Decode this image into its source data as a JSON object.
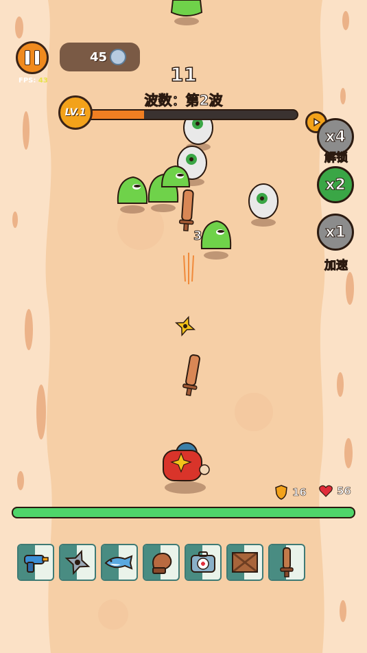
{
  "hud": {
    "fps_label": "FPS:",
    "fps_value": "43",
    "coins": "45",
    "timer": "11",
    "wave_text": "波数：第2波",
    "level": "LV.1",
    "xp_progress": 0.3
  },
  "speed": {
    "x4_label": "x4",
    "x4_caption": "解锁",
    "x2_label": "x2",
    "x1_label": "x1",
    "x1_caption": "加速"
  },
  "player": {
    "shield": "16",
    "hearts": "56",
    "hp_fraction": 1.0
  },
  "damage_popup": "3",
  "weapons": [
    "water-gun-icon",
    "shuriken-icon",
    "shark-icon",
    "boxing-glove-icon",
    "medkit-icon",
    "crate-icon",
    "wooden-sword-icon"
  ],
  "colors": {
    "sand": "#f6cfa6",
    "accent_orange": "#f08a1e",
    "hp_green": "#4fd56a",
    "slime_green": "#6fd24a"
  }
}
